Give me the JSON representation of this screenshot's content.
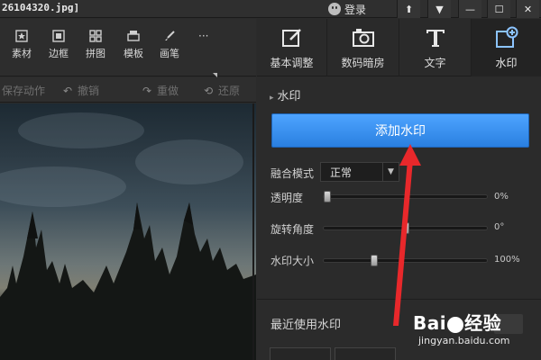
{
  "window": {
    "title": "26104320.jpg]",
    "login_label": "登录",
    "buttons": [
      "⬆",
      "▼",
      "—",
      "☐",
      "✕"
    ]
  },
  "toolbar": {
    "items": [
      {
        "label": "素材",
        "icon": "star-square-icon"
      },
      {
        "label": "边框",
        "icon": "frame-icon"
      },
      {
        "label": "拼图",
        "icon": "grid-icon"
      },
      {
        "label": "模板",
        "icon": "template-icon"
      },
      {
        "label": "画笔",
        "icon": "brush-icon"
      }
    ],
    "more": "···"
  },
  "right_tabs": [
    {
      "label": "基本调整",
      "icon": "edit-icon",
      "active": false
    },
    {
      "label": "数码暗房",
      "icon": "camera-icon",
      "active": false
    },
    {
      "label": "文字",
      "icon": "text-icon",
      "active": false
    },
    {
      "label": "水印",
      "icon": "watermark-icon",
      "active": true
    }
  ],
  "actions": [
    {
      "label": "保存动作"
    },
    {
      "label": "撤销"
    },
    {
      "label": "重做"
    },
    {
      "label": "还原"
    }
  ],
  "panel": {
    "section_title": "水印",
    "add_button": "添加水印",
    "blend_mode_label": "融合模式",
    "blend_mode_value": "正常",
    "opacity_label": "透明度",
    "opacity_value": "0%",
    "opacity_fraction": 0.0,
    "rotation_label": "旋转角度",
    "rotation_value": "0°",
    "rotation_fraction": 0.5,
    "size_label": "水印大小",
    "size_value": "100%",
    "size_fraction": 0.3,
    "recent_label": "最近使用水印"
  },
  "watermark": {
    "brand": "Bai",
    "brand2": "经验",
    "url": "jingyan.baidu.com"
  },
  "colors": {
    "accent": "#2a7fe0",
    "arrow": "#e8282b"
  }
}
